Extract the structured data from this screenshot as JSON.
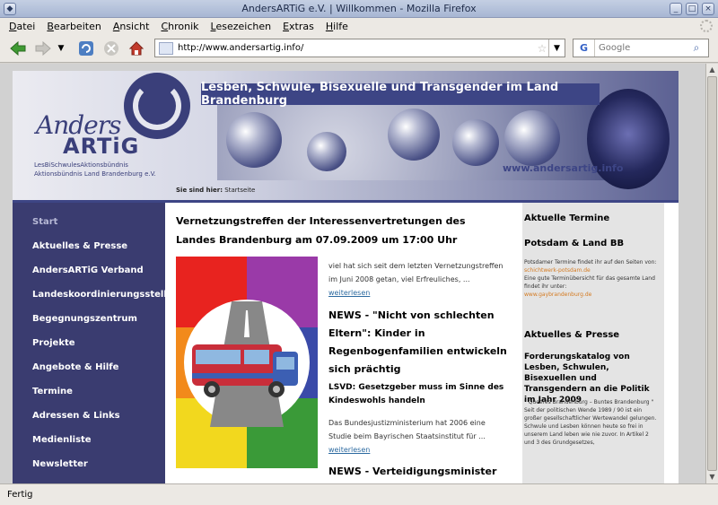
{
  "window": {
    "title": "AndersARTiG e.V. | Willkommen - Mozilla Firefox"
  },
  "menu": [
    "Datei",
    "Bearbeiten",
    "Ansicht",
    "Chronik",
    "Lesezeichen",
    "Extras",
    "Hilfe"
  ],
  "toolbar": {
    "url": "http://www.andersartig.info/",
    "search_placeholder": "Google",
    "search_engine_label": "G"
  },
  "banner": {
    "logo_main": "Anders",
    "logo_sub": "ARTiG",
    "logo_tag1": "LesBiSchwulesAktionsbündnis",
    "logo_tag2": "Aktionsbündnis Land Brandenburg e.V.",
    "strip_text": "Lesben, Schwule, Bisexuelle und Transgender im Land Brandenburg",
    "url_text": "www.andersartig.info",
    "breadcrumb_label": "Sie sind hier:",
    "breadcrumb_page": "Startseite"
  },
  "nav": [
    "Start",
    "Aktuelles & Presse",
    "AndersARTiG Verband",
    "Landeskoordinierungsstelle",
    "Begegnungszentrum",
    "Projekte",
    "Angebote & Hilfe",
    "Termine",
    "Adressen & Links",
    "Medienliste",
    "Newsletter"
  ],
  "main": {
    "headline": "Vernetzungstreffen der Interessenvertretungen des Landes Brandenburg am 07.09.2009 um 17:00 Uhr",
    "p1": "viel hat sich seit dem letzten Vernetzungstreffen im Juni 2008 getan, viel Erfreuliches, ...",
    "p1_more": "weiterlesen",
    "news1": "NEWS - \"Nicht von schlechten Eltern\": Kinder in Regenbogenfamilien entwickeln sich prächtig",
    "lsvd": "LSVD: Gesetzgeber muss im Sinne des Kindeswohls handeln",
    "p2": "Das Bundesjustizministerium hat 2006 eine Studie beim Bayrischen Staatsinstitut für ...",
    "p2_more": "weiterlesen",
    "news2": "NEWS - Verteidigungsminister"
  },
  "right": {
    "termine_heading": "Aktuelle Termine",
    "region_heading": "Potsdam & Land BB",
    "termine_text1": "Potsdamer Termine findet ihr auf den Seiten von:",
    "termine_link1": "schichtwerk-potsdam.de",
    "termine_text2": "Eine gute Terminübersicht für das gesamte Land findet ihr unter:",
    "termine_link2": "www.gaybrandenburg.de",
    "press_heading": "Aktuelles & Presse",
    "press_title": "Forderungskatalog von Lesben, Schwulen, Bisexuellen und Transgendern an die Politik im Jahr 2009",
    "press_text": "\" Queeres Brandenburg – Buntes Brandenburg \" Seit der politischen Wende 1989 / 90 ist ein großer gesellschaftlicher Wertewandel gelungen. Schwule und Lesben können heute so frei in unserem Land leben wie nie zuvor. In Artikel 2 und 3 des Grundgesetzes,"
  },
  "status": {
    "text": "Fertig"
  }
}
